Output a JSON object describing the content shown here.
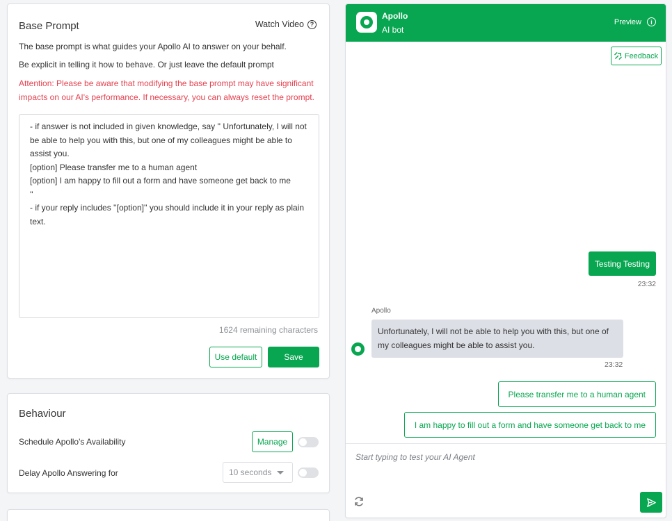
{
  "base_prompt": {
    "title": "Base Prompt",
    "watch_video": "Watch Video",
    "desc1": "The base prompt is what guides your Apollo AI to answer on your behalf.",
    "desc2": "Be explicit in telling it how to behave. Or just leave the default prompt",
    "attention": "Attention: Please be aware that modifying the base prompt may have significant impacts on our AI's performance. If necessary, you can always reset the prompt.",
    "prompt_text": "- if answer is not included in given knowledge, say '' Unfortunately, I will not be able to help you with this, but one of my colleagues might be able to assist you.\n[option] Please transfer me to a human agent\n[option] I am happy to fill out a form and have someone get back to me\n''\n- if your reply includes ''[option]'' you should include it in your reply as plain text.",
    "remaining": "1624 remaining characters",
    "use_default_label": "Use default",
    "save_label": "Save"
  },
  "behaviour": {
    "title": "Behaviour",
    "schedule_label": "Schedule Apollo's Availability",
    "manage_label": "Manage",
    "delay_label": "Delay Apollo Answering for",
    "delay_value": "10 seconds"
  },
  "chat": {
    "bot_name": "Apollo",
    "bot_subtitle": "AI bot",
    "preview_label": "Preview",
    "feedback_label": "Feedback",
    "messages": [
      {
        "from": "user",
        "text": "Testing Testing",
        "time": "23:32"
      },
      {
        "from": "bot",
        "sender": "Apollo",
        "text": "Unfortunately, I will not be able to help you with this, but one of my colleagues might be able to assist you.",
        "time": "23:32"
      }
    ],
    "options": [
      "Please transfer me to a human agent",
      "I am happy to fill out a form and have someone get back to me"
    ],
    "input_placeholder": "Start typing to test your AI Agent"
  },
  "colors": {
    "accent": "#08a650",
    "warning": "#e4414f",
    "bot_bubble": "#dcdfe6"
  },
  "icons": {
    "watch_video": "question-circle-icon",
    "preview": "info-icon",
    "feedback": "feedback-icon",
    "refresh": "refresh-icon",
    "send": "send-icon"
  }
}
